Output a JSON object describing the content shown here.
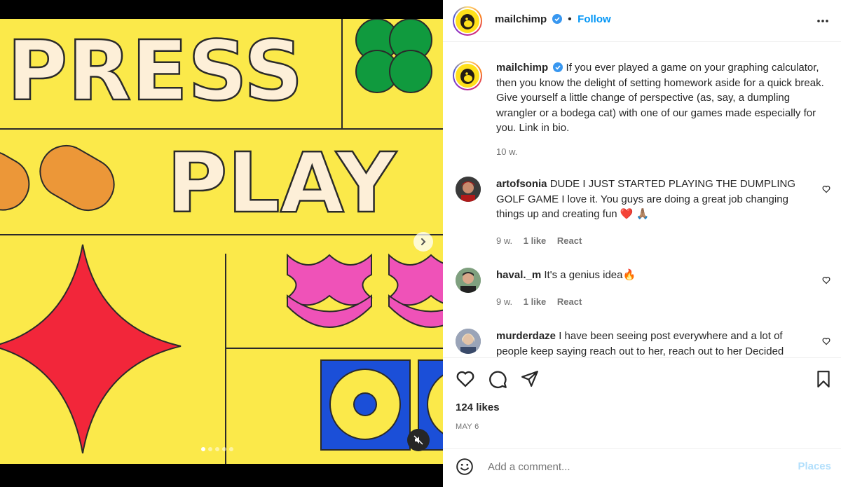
{
  "media": {
    "art_letters": {
      "press": "PRESS",
      "play": "PLAY"
    },
    "carousel_count": 5,
    "carousel_active_index": 0,
    "colors": {
      "background": "#fbe94a",
      "cream": "#fdefd8",
      "green": "#109a3e",
      "orange": "#ec9738",
      "red": "#f2263a",
      "pink": "#ef52b8",
      "blue": "#1b4fd8"
    },
    "icons": {
      "next": "chevron-right-icon",
      "mute": "speaker-muted-icon"
    }
  },
  "header": {
    "username": "mailchimp",
    "separator": "•",
    "follow_label": "Follow",
    "more_icon": "ellipsis-icon"
  },
  "caption": {
    "username": "mailchimp",
    "text": "If you ever played a game on your graphing calculator, then you know the delight of setting homework aside for a quick break. Give yourself a little change of perspective (as, say, a dumpling wrangler or a bodega cat) with one of our games made especially for you. Link in bio.",
    "time": "10 w."
  },
  "comments": [
    {
      "username": "artofsonia",
      "text": "DUDE I JUST STARTED PLAYING THE DUMPLING GOLF GAME I love it. You guys are doing a great job changing things up and creating fun",
      "emoji": "❤️ 🙏🏽",
      "time": "9 w.",
      "likes": "1 like",
      "react": "React"
    },
    {
      "username": "haval._m",
      "text": "It's a genius idea🔥",
      "time": "9 w.",
      "likes": "1 like",
      "react": "React"
    },
    {
      "username": "murderdaze",
      "text": "I have been seeing post everywhere and a lot of people keep saying reach out to her, reach out to her Decided"
    }
  ],
  "actions": {
    "icons": [
      "heart-icon",
      "comment-icon",
      "share-icon",
      "bookmark-icon"
    ],
    "likes": "124 likes",
    "date": "MAY 6"
  },
  "add_comment": {
    "placeholder": "Add a comment...",
    "post_label": "Places",
    "emoji_icon": "smiley-icon"
  },
  "colors": {
    "accent": "#0095f6",
    "muted": "#737373",
    "post_disabled": "#b2dffc",
    "verified": "#3897f0"
  }
}
